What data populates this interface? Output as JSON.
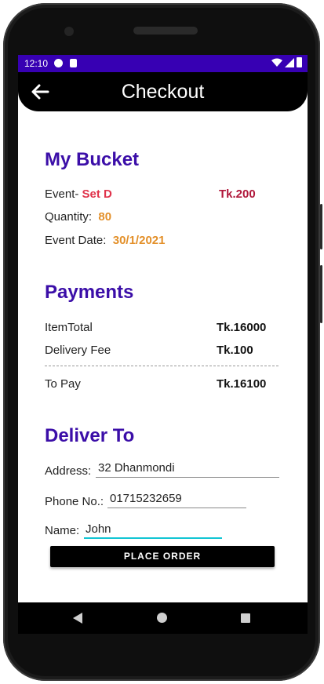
{
  "status_bar": {
    "time": "12:10"
  },
  "app_bar": {
    "title": "Checkout"
  },
  "bucket": {
    "heading": "My Bucket",
    "event_label": "Event-",
    "event_value": "Set D",
    "event_price": "Tk.200",
    "quantity_label": "Quantity:",
    "quantity_value": "80",
    "date_label": "Event Date:",
    "date_value": "30/1/2021"
  },
  "payments": {
    "heading": "Payments",
    "rows": [
      {
        "label": "ItemTotal",
        "value": "Tk.16000"
      },
      {
        "label": "Delivery Fee",
        "value": "Tk.100"
      },
      {
        "label": "To Pay",
        "value": "Tk.16100"
      }
    ]
  },
  "deliver": {
    "heading": "Deliver To",
    "address_label": "Address:",
    "address_value": "32 Dhanmondi",
    "phone_label": "Phone No.:",
    "phone_value": "01715232659",
    "name_label": "Name:",
    "name_value": "John"
  },
  "place_order_label": "PLACE ORDER",
  "colors": {
    "status_bar": "#3700b3",
    "heading": "#3b0ea8",
    "accent_red": "#e0334b",
    "accent_orange": "#e3902a",
    "active_underline": "#12c5d4"
  },
  "icons": [
    "back-arrow-icon",
    "wifi-icon",
    "signal-icon",
    "battery-icon",
    "nav-back-icon",
    "nav-home-icon",
    "nav-recents-icon"
  ]
}
